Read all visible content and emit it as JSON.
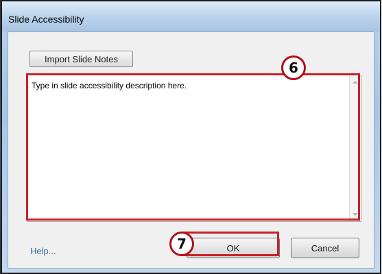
{
  "dialog": {
    "title": "Slide Accessibility",
    "import_button_label": "Import Slide Notes",
    "description_text": "Type in slide accessibility description here.",
    "help_link": "Help...",
    "ok_label": "OK",
    "cancel_label": "Cancel"
  },
  "annotations": {
    "step_6": "6",
    "step_7": "7",
    "highlight_color": "#cc1f26"
  }
}
